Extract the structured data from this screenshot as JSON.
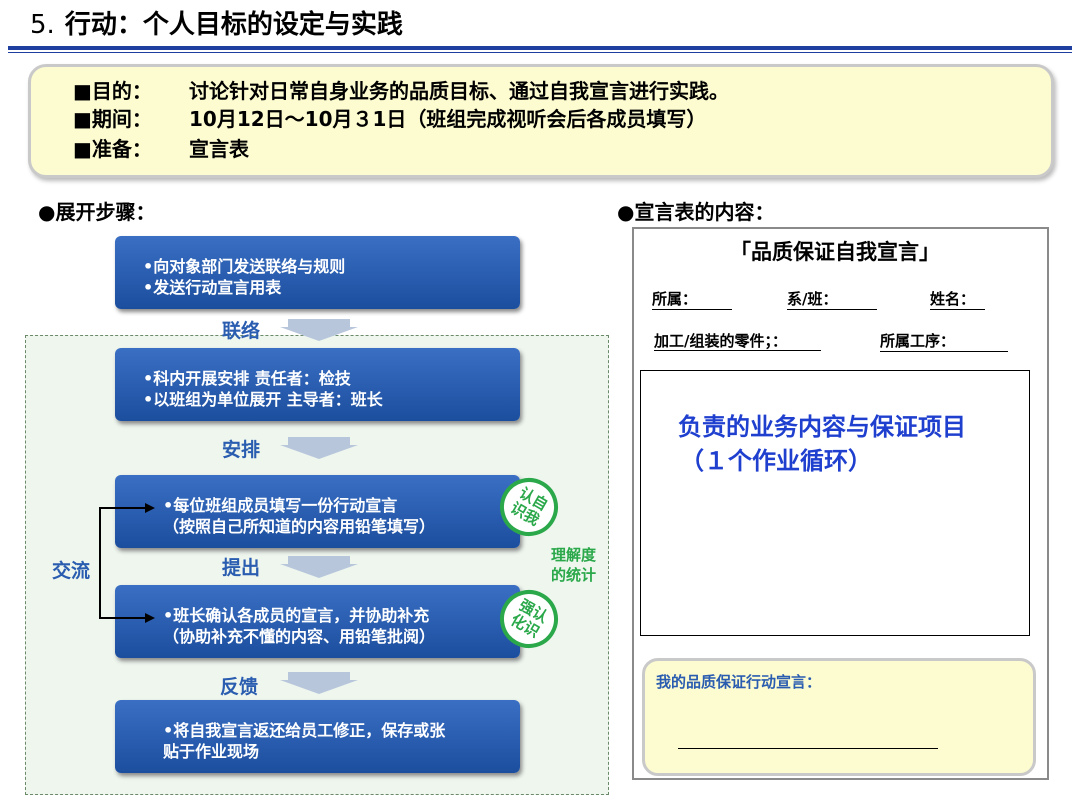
{
  "header": {
    "number": "5.",
    "title": "行动：个人目标的设定与实践"
  },
  "info": {
    "rows": [
      {
        "label": "■目的：",
        "text": "讨论针对日常自身业务的品质目标、通过自我宣言进行实践。"
      },
      {
        "label": "■期间：",
        "text": "10月12日～10月３1日（班组完成视听会后各成员填写）"
      },
      {
        "label": "■准备：",
        "text": "宣言表"
      }
    ]
  },
  "left": {
    "heading": "●展开步骤：",
    "steps": [
      {
        "lines": [
          "•向对象部门发送联络与规则",
          "•发送行动宣言用表"
        ]
      },
      {
        "lines": [
          "•科内开展安排    责任者：检技",
          "•以班组为单位展开    主导者：班长"
        ]
      },
      {
        "lines": [
          "•每位班组成员填写一份行动宣言",
          "（按照自己所知道的内容用铅笔填写）"
        ]
      },
      {
        "lines": [
          "•班长确认各成员的宣言，并协助补充",
          "（协助补充不懂的内容、用铅笔批阅）"
        ]
      },
      {
        "lines": [
          "•将自我宣言返还给员工修正，保存或张",
          "贴于作业现场"
        ]
      }
    ],
    "step_labels": [
      "联络",
      "安排",
      "提出",
      "反馈"
    ],
    "exchange_label": "交流",
    "badge1": [
      "认自",
      "识我"
    ],
    "badge2": [
      "强认",
      "化识"
    ],
    "understanding": [
      "理解度",
      "的统计"
    ]
  },
  "right": {
    "heading": "●宣言表的内容：",
    "form_title": "「品质保证自我宣言」",
    "fields_row1": [
      "所属：",
      "系/班：",
      "姓名："
    ],
    "field_part": "加工/组装的零件；：",
    "field_process": "所属工序：",
    "box_lines": [
      "负责的业务内容与保证项目",
      "（１个作业循环）"
    ],
    "declaration_label": "我的品质保证行动宣言："
  },
  "colors": {
    "rule": "#1f3fa0",
    "step_blue": "#1c4e9e",
    "label_blue": "#2a5db0",
    "green": "#2aa84a",
    "highlight_blue": "#1f3fcf",
    "yellow": "#fdfbd0"
  }
}
